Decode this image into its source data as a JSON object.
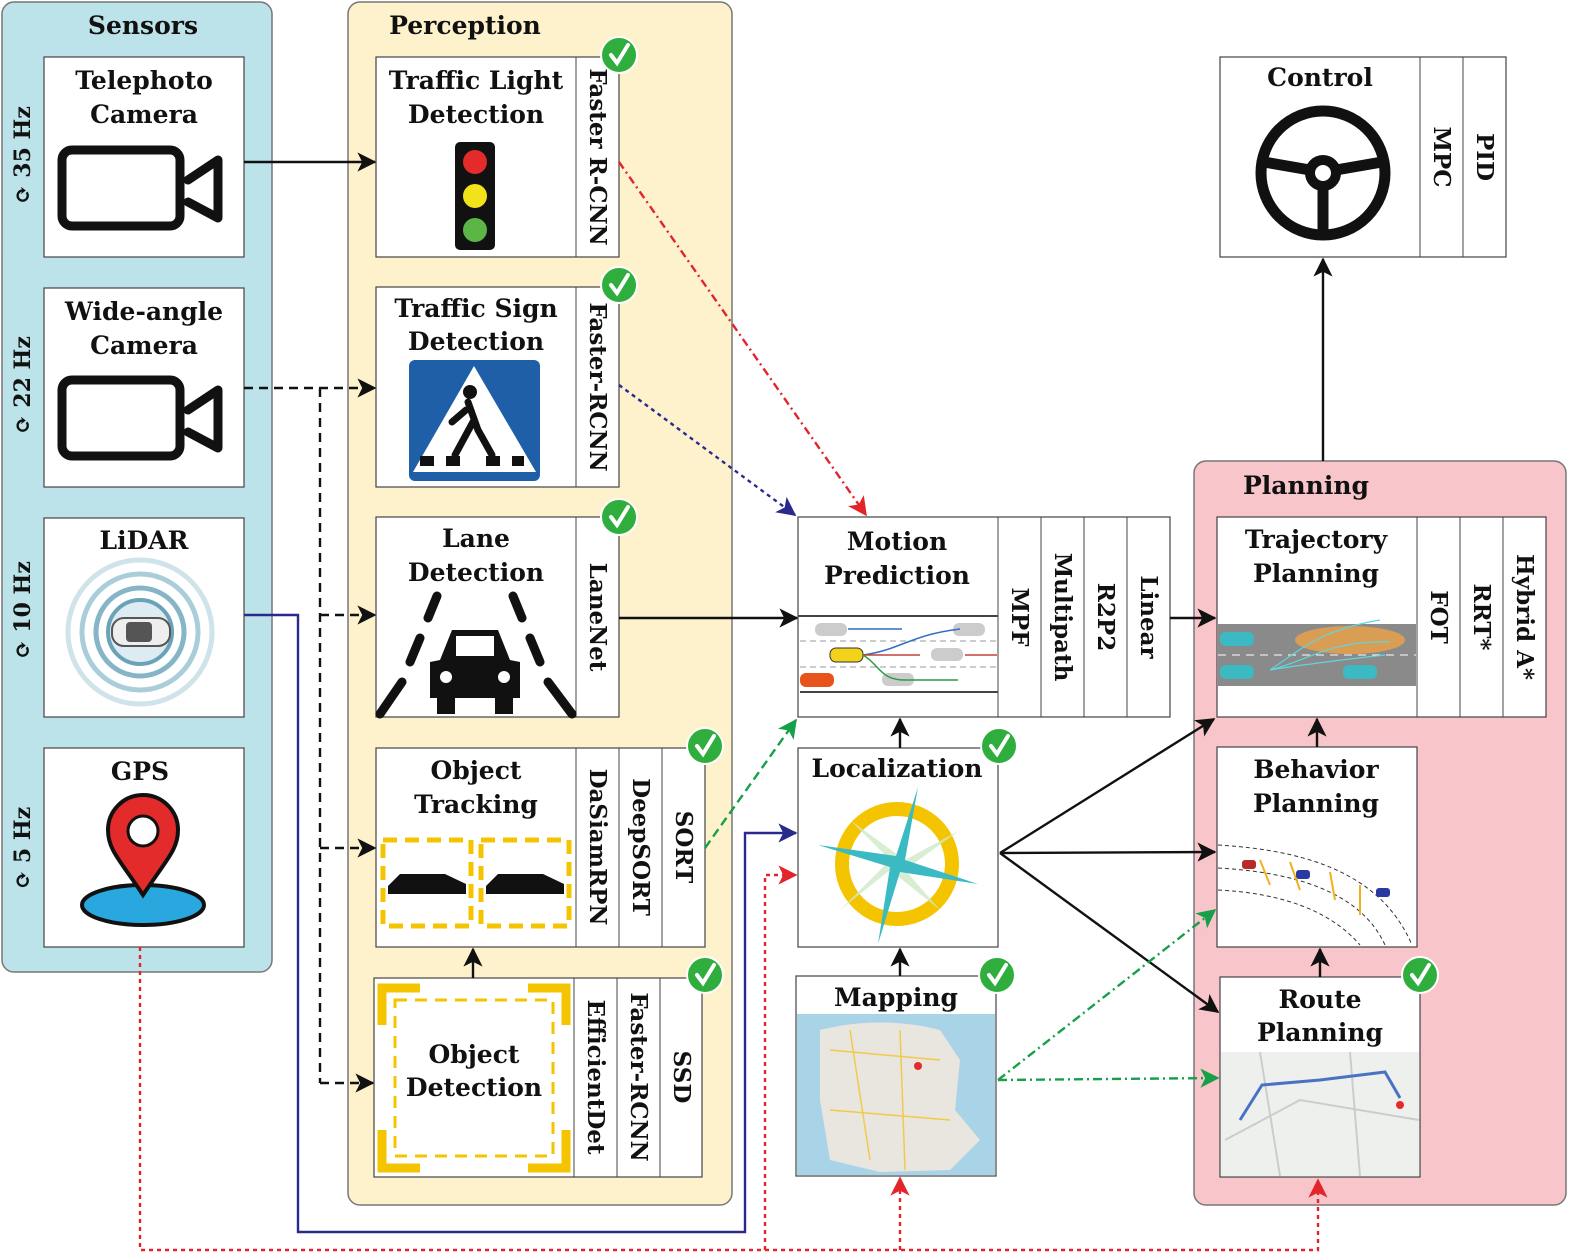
{
  "sensors": {
    "title": "Sensors",
    "refresh_icon": "refresh-cycle-icon",
    "refresh_glyph": "⟳",
    "items": [
      {
        "label": [
          "Telephoto",
          "Camera"
        ],
        "rate": "35 Hz",
        "icon": "video-camera-icon"
      },
      {
        "label": [
          "Wide-angle",
          "Camera"
        ],
        "rate": "22 Hz",
        "icon": "video-camera-icon"
      },
      {
        "label": [
          "LiDAR"
        ],
        "rate": "10 Hz",
        "icon": "lidar-car-icon"
      },
      {
        "label": [
          "GPS"
        ],
        "rate": "5 Hz",
        "icon": "map-pin-icon"
      }
    ]
  },
  "perception": {
    "title": "Perception",
    "traffic_light": {
      "label": [
        "Traffic Light",
        "Detection"
      ],
      "methods": [
        "Faster R-CNN"
      ]
    },
    "traffic_sign": {
      "label": [
        "Traffic Sign",
        "Detection"
      ],
      "methods": [
        "Faster-RCNN"
      ]
    },
    "lane": {
      "label": [
        "Lane",
        "Detection"
      ],
      "methods": [
        "LaneNet"
      ]
    },
    "tracking": {
      "label": [
        "Object",
        "Tracking"
      ],
      "methods": [
        "DaSiamRPN",
        "DeepSORT",
        "SORT"
      ]
    },
    "detection": {
      "label": [
        "Object",
        "Detection"
      ],
      "methods": [
        "EfficientDet",
        "Faster-RCNN",
        "SSD"
      ]
    }
  },
  "motion_prediction": {
    "label": [
      "Motion",
      "Prediction"
    ],
    "methods": [
      "MPF",
      "Multipath",
      "R2P2",
      "Linear"
    ]
  },
  "localization": {
    "label": "Localization"
  },
  "mapping": {
    "label": "Mapping"
  },
  "control": {
    "label": "Control",
    "methods": [
      "MPC",
      "PID"
    ]
  },
  "planning": {
    "title": "Planning",
    "trajectory": {
      "label": [
        "Trajectory",
        "Planning"
      ],
      "methods": [
        "FOT",
        "RRT*",
        "Hybrid A*"
      ]
    },
    "behavior": {
      "label": [
        "Behavior",
        "Planning"
      ]
    },
    "route": {
      "label": [
        "Route",
        "Planning"
      ]
    }
  },
  "colors": {
    "sensors_bg": "#bde3ea",
    "perception_bg": "#fdf2cc",
    "planning_bg": "#f7c5ca",
    "check_green": "#2fae3e",
    "red_link": "#e3242b",
    "blue_link": "#2a2a8c",
    "green_link": "#16a04a"
  }
}
